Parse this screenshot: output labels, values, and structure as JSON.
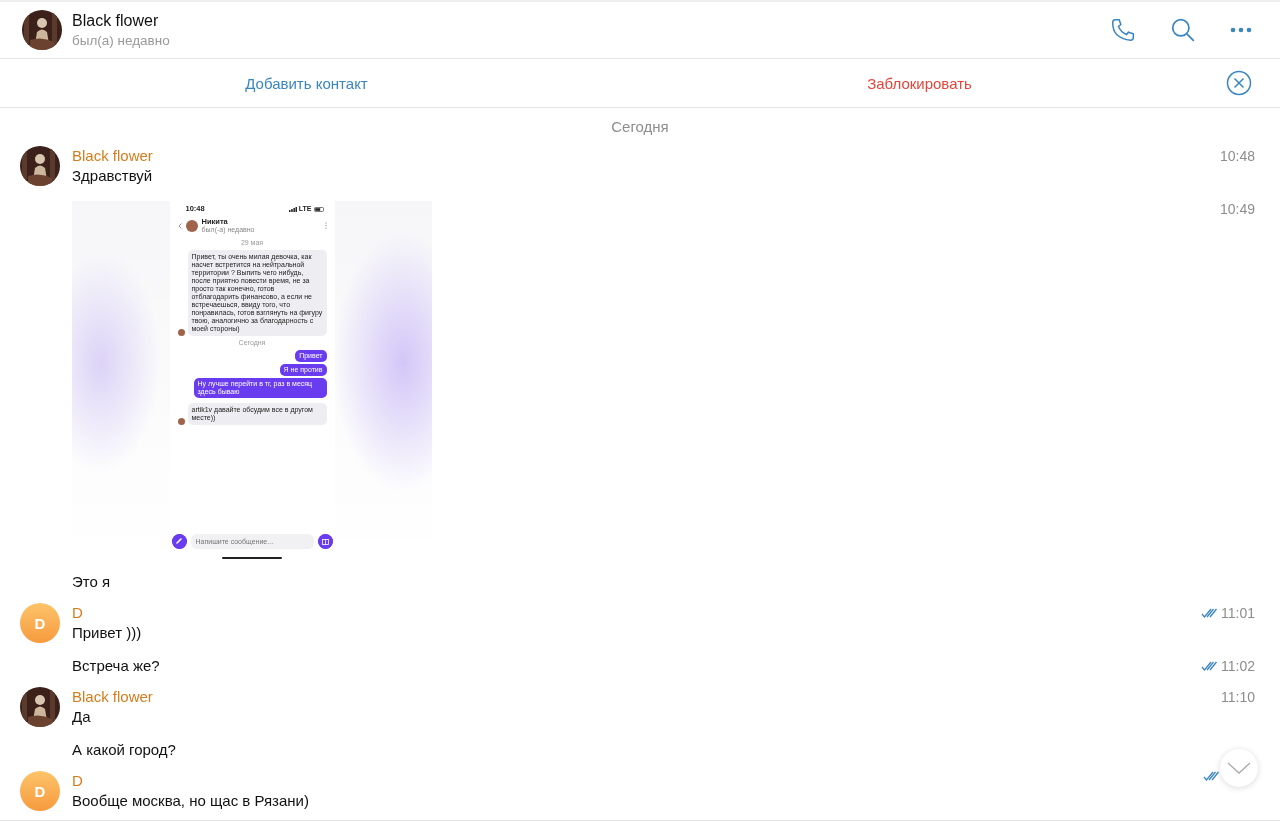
{
  "header": {
    "name": "Black flower",
    "status": "был(а) недавно"
  },
  "contact_bar": {
    "add": "Добавить контакт",
    "block": "Заблокировать"
  },
  "date_divider": "Сегодня",
  "messages": [
    {
      "sender": {
        "name": "Black flower"
      },
      "kind": "text",
      "text": "Здравствуй",
      "time": "10:48",
      "read": false
    },
    {
      "time": "10:49",
      "read": false,
      "screenshot": {
        "clock": "10:48",
        "network": "LTE",
        "contact": "Никита",
        "contact_status": "был(-а) недавно",
        "date_old": "29 мая",
        "date_new": "Сегодня",
        "incoming_1": "Привет, ты очень милая девочка, как насчет встретится на нейтральной территории ? Выпить чего нибудь, после приятно повести время,  не за просто так конечно, готов отблагодарить финансово, а если не встречаешься, ввиду того, что понравилась, готов взглянуть на фигуру твою, аналогично за благодарность с моей стороны)",
        "outgoing": [
          "Привет",
          "Я не против",
          "Ну лучше перейти в тг, раз в месяц здесь бываю"
        ],
        "incoming_2": "artik1v давайте обсудим все в другом месте))",
        "placeholder": "Напишите сообщение..."
      }
    },
    {
      "kind": "text",
      "text": "Это я",
      "read": false
    },
    {
      "sender": {
        "name": "D",
        "avatar": {
          "kind": "letter",
          "letter": "D"
        }
      },
      "kind": "text",
      "text": "Привет )))",
      "time": "11:01",
      "read": true
    },
    {
      "kind": "text",
      "text": "Встреча же?",
      "time": "11:02",
      "read": true
    },
    {
      "sender": {
        "name": "Black flower"
      },
      "kind": "text",
      "text": "Да",
      "time": "11:10",
      "read": false
    },
    {
      "kind": "text",
      "text": "А какой город?",
      "read": false
    },
    {
      "sender": {
        "name": "D",
        "avatar": {
          "kind": "letter",
          "letter": "D"
        }
      },
      "kind": "text",
      "text": "Вообще москва, но щас в Рязани)",
      "read": true
    }
  ]
}
